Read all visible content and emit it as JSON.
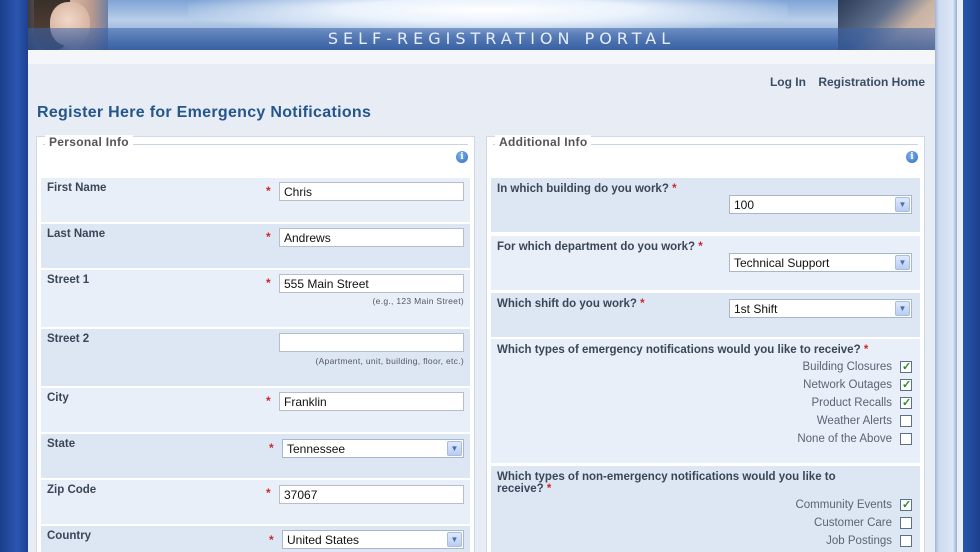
{
  "banner": {
    "title": "SELF-REGISTRATION PORTAL"
  },
  "nav": {
    "login": "Log In",
    "registration_home": "Registration Home"
  },
  "page_title": "Register Here for Emergency Notifications",
  "personal": {
    "legend": "Personal Info",
    "fields": {
      "first_name": {
        "label": "First Name",
        "value": "Chris"
      },
      "last_name": {
        "label": "Last Name",
        "value": "Andrews"
      },
      "street1": {
        "label": "Street 1",
        "value": "555 Main Street",
        "hint": "(e.g., 123 Main Street)"
      },
      "street2": {
        "label": "Street 2",
        "value": "",
        "hint": "(Apartment, unit, building, floor, etc.)"
      },
      "city": {
        "label": "City",
        "value": "Franklin"
      },
      "state": {
        "label": "State",
        "value": "Tennessee"
      },
      "zip": {
        "label": "Zip Code",
        "value": "37067"
      },
      "country": {
        "label": "Country",
        "value": "United States"
      }
    }
  },
  "additional": {
    "legend": "Additional Info",
    "building": {
      "label": "In which building do you work?",
      "value": "100"
    },
    "department": {
      "label": "For which department do you work?",
      "value": "Technical Support"
    },
    "shift": {
      "label": "Which shift do you work?",
      "value": "1st Shift"
    },
    "emergency": {
      "label": "Which types of emergency notifications would you like to receive?",
      "options": [
        {
          "label": "Building Closures",
          "checked": true
        },
        {
          "label": "Network Outages",
          "checked": true
        },
        {
          "label": "Product Recalls",
          "checked": true
        },
        {
          "label": "Weather Alerts",
          "checked": false
        },
        {
          "label": "None of the Above",
          "checked": false
        }
      ]
    },
    "non_emergency": {
      "label_line1": "Which types of non-emergency notifications would you like to",
      "label_line2": "receive?",
      "options": [
        {
          "label": "Community Events",
          "checked": true
        },
        {
          "label": "Customer Care",
          "checked": false
        },
        {
          "label": "Job Postings",
          "checked": false
        }
      ]
    }
  },
  "required_mark": "*",
  "info_icon_glyph": "i",
  "dropdown_glyph": "▼"
}
